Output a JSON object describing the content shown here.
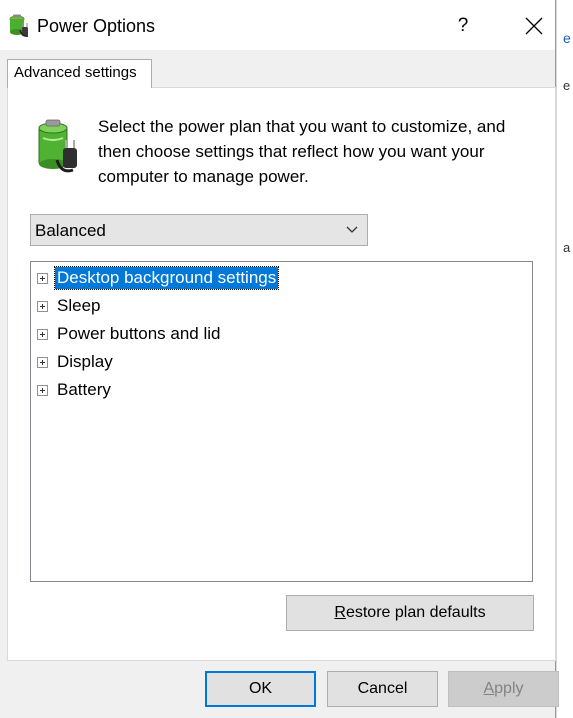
{
  "window": {
    "title": "Power Options",
    "help_label": "?"
  },
  "tab": {
    "label": "Advanced settings"
  },
  "description": "Select the power plan that you want to customize, and then choose settings that reflect how you want your computer to manage power.",
  "plan_select": {
    "value": "Balanced"
  },
  "tree": {
    "items": [
      {
        "label": "Desktop background settings",
        "selected": true
      },
      {
        "label": "Sleep"
      },
      {
        "label": "Power buttons and lid"
      },
      {
        "label": "Display"
      },
      {
        "label": "Battery"
      }
    ]
  },
  "buttons": {
    "restore_mnemonic": "R",
    "restore_rest": "estore plan defaults",
    "ok": "OK",
    "cancel": "Cancel",
    "apply_mnemonic": "A",
    "apply_rest": "pply"
  },
  "background_fragments": {
    "a": "e",
    "b": "e",
    "c": "a"
  },
  "colors": {
    "selection": "#0078d7",
    "default_border": "#0078d7"
  }
}
